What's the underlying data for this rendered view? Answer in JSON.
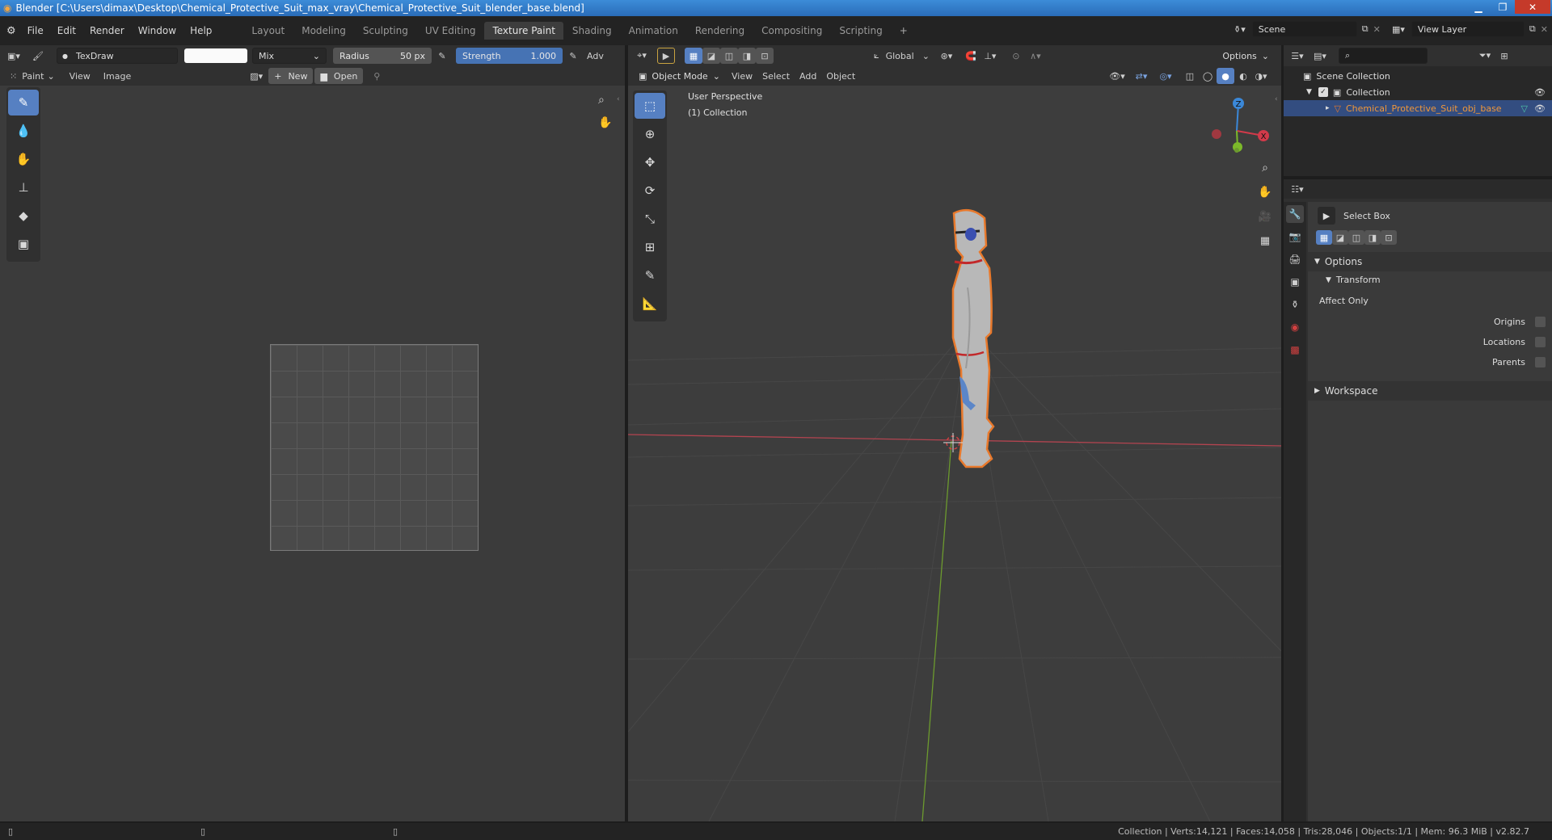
{
  "window": {
    "title": "Blender [C:\\Users\\dimax\\Desktop\\Chemical_Protective_Suit_max_vray\\Chemical_Protective_Suit_blender_base.blend]"
  },
  "menu": [
    "File",
    "Edit",
    "Render",
    "Window",
    "Help"
  ],
  "workspaces": [
    {
      "label": "Layout",
      "active": false
    },
    {
      "label": "Modeling",
      "active": false
    },
    {
      "label": "Sculpting",
      "active": false
    },
    {
      "label": "UV Editing",
      "active": false
    },
    {
      "label": "Texture Paint",
      "active": true
    },
    {
      "label": "Shading",
      "active": false
    },
    {
      "label": "Animation",
      "active": false
    },
    {
      "label": "Rendering",
      "active": false
    },
    {
      "label": "Compositing",
      "active": false
    },
    {
      "label": "Scripting",
      "active": false
    }
  ],
  "scene": {
    "name": "Scene",
    "view_layer": "View Layer"
  },
  "image_editor": {
    "brush_name": "TexDraw",
    "blend": "Mix",
    "radius_label": "Radius",
    "radius_value": "50 px",
    "strength_label": "Strength",
    "strength_value": "1.000",
    "advanced": "Adv",
    "mode": "Paint",
    "menus": [
      "View",
      "Image"
    ],
    "new_label": "New",
    "open_label": "Open"
  },
  "viewport": {
    "transform": "Global",
    "options": "Options",
    "mode": "Object Mode",
    "menus": [
      "View",
      "Select",
      "Add",
      "Object"
    ],
    "overlay_line1": "User Perspective",
    "overlay_line2": "(1) Collection",
    "gizmo_axes": [
      "Z",
      "X"
    ]
  },
  "outliner": {
    "scene_collection": "Scene Collection",
    "collection": "Collection",
    "object": "Chemical_Protective_Suit_obj_base"
  },
  "properties": {
    "tool_name": "Select Box",
    "options": "Options",
    "transform": "Transform",
    "affect_only": "Affect Only",
    "origins": "Origins",
    "locations": "Locations",
    "parents": "Parents",
    "workspace": "Workspace"
  },
  "status": "Collection | Verts:14,121 | Faces:14,058 | Tris:28,046 | Objects:1/1 | Mem: 96.3 MiB | v2.82.7",
  "colors": {
    "accent": "#5680c2",
    "selection_outline": "#e8792c",
    "x_axis": "#d23a4a",
    "y_axis": "#7cb92a",
    "z_axis": "#3b88d8"
  }
}
